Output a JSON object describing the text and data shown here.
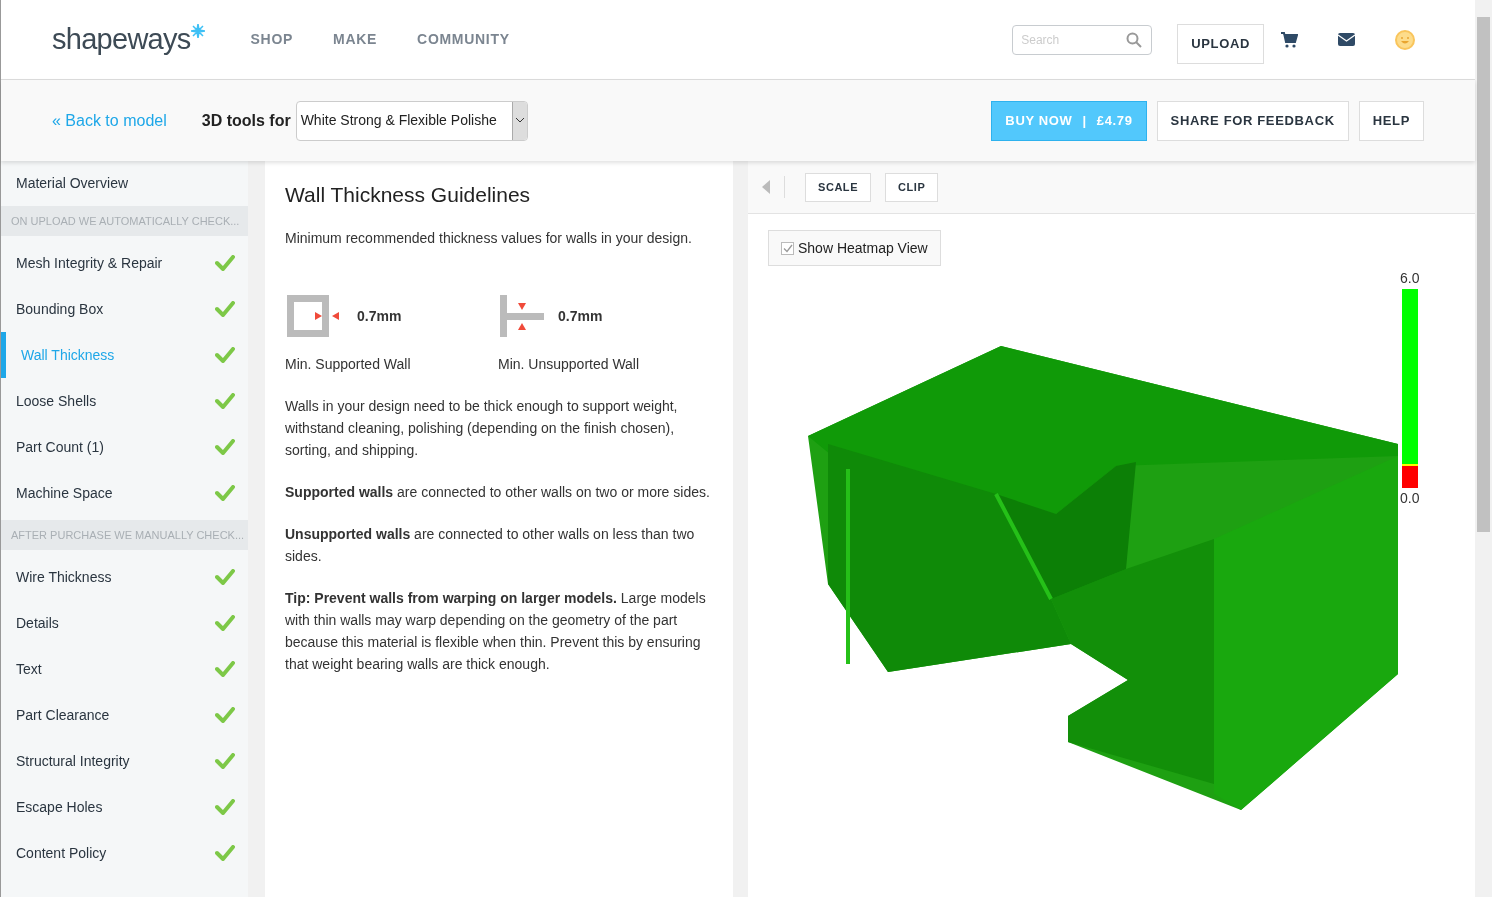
{
  "header": {
    "logo": "shapeways",
    "nav": [
      "SHOP",
      "MAKE",
      "COMMUNITY"
    ],
    "search": {
      "placeholder": "Search"
    },
    "upload": "UPLOAD"
  },
  "toolbar": {
    "back": "« Back to model",
    "tools_label": "3D tools for",
    "material": "White Strong & Flexible Polishe",
    "buy": "BUY NOW",
    "separator": "|",
    "price": "£4.79",
    "share": "SHARE FOR FEEDBACK",
    "help": "HELP"
  },
  "sidebar": {
    "overview": "Material Overview",
    "sections": [
      {
        "heading": "ON UPLOAD WE AUTOMATICALLY CHECK...",
        "items": [
          {
            "label": "Mesh Integrity & Repair",
            "selected": false,
            "checked": true
          },
          {
            "label": "Bounding Box",
            "selected": false,
            "checked": true
          },
          {
            "label": "Wall Thickness",
            "selected": true,
            "checked": true
          },
          {
            "label": "Loose Shells",
            "selected": false,
            "checked": true
          },
          {
            "label": "Part Count (1)",
            "selected": false,
            "checked": true
          },
          {
            "label": "Machine Space",
            "selected": false,
            "checked": true
          }
        ]
      },
      {
        "heading": "AFTER PURCHASE WE MANUALLY CHECK...",
        "items": [
          {
            "label": "Wire Thickness",
            "selected": false,
            "checked": true
          },
          {
            "label": "Details",
            "selected": false,
            "checked": true
          },
          {
            "label": "Text",
            "selected": false,
            "checked": true
          },
          {
            "label": "Part Clearance",
            "selected": false,
            "checked": true
          },
          {
            "label": "Structural Integrity",
            "selected": false,
            "checked": true
          },
          {
            "label": "Escape Holes",
            "selected": false,
            "checked": true
          },
          {
            "label": "Content Policy",
            "selected": false,
            "checked": true
          }
        ]
      }
    ]
  },
  "content": {
    "title": "Wall Thickness Guidelines",
    "intro": "Minimum recommended thickness values for walls in your design.",
    "guides": [
      {
        "kind": "supported",
        "value": "0.7mm",
        "caption": "Min. Supported Wall"
      },
      {
        "kind": "unsupported",
        "value": "0.7mm",
        "caption": "Min. Unsupported Wall"
      }
    ],
    "paragraphs": [
      "Walls in your design need to be thick enough to support weight, withstand cleaning, polishing (depending on the finish chosen), sorting, and shipping.",
      "**Supported walls** are connected to other walls on two or more sides.",
      "**Unsupported walls** are connected to other walls on less than two sides.",
      "**Tip: Prevent walls from warping on larger models.** Large models with thin walls may warp depending on the geometry of the part because this material is flexible when thin. Prevent this by ensuring that weight bearing walls are thick enough."
    ]
  },
  "viewer": {
    "tools": [
      "SCALE",
      "CLIP"
    ],
    "heatmap": {
      "label": "Show Heatmap View",
      "checked": true
    },
    "legend": {
      "max": "6.0",
      "min": "0.0"
    }
  }
}
